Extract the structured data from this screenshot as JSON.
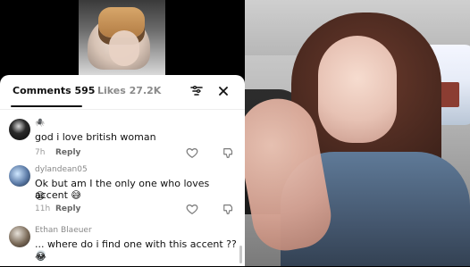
{
  "tabs": {
    "comments_label": "Comments 595",
    "likes_label": "Likes 27.2K"
  },
  "comments": [
    {
      "username": "🕷️",
      "text": "god i love british woman",
      "time": "7h",
      "reply_label": "Reply"
    },
    {
      "username": "dylandean05",
      "text": "Ok but am I the only one who loves accent 😅",
      "text2": "😩",
      "time": "11h",
      "reply_label": "Reply"
    },
    {
      "username": "Ethan Blaeuer",
      "text": "... where do i find one with this accent ?? 💀",
      "text2": "😂"
    }
  ],
  "icons": {
    "filter": "filter-icon",
    "close": "close-icon",
    "like": "heart-outline-icon",
    "dislike": "thumbs-down-icon"
  },
  "colors": {
    "panel_bg": "#ffffff",
    "text": "#111111",
    "muted": "#8a8a8a"
  }
}
